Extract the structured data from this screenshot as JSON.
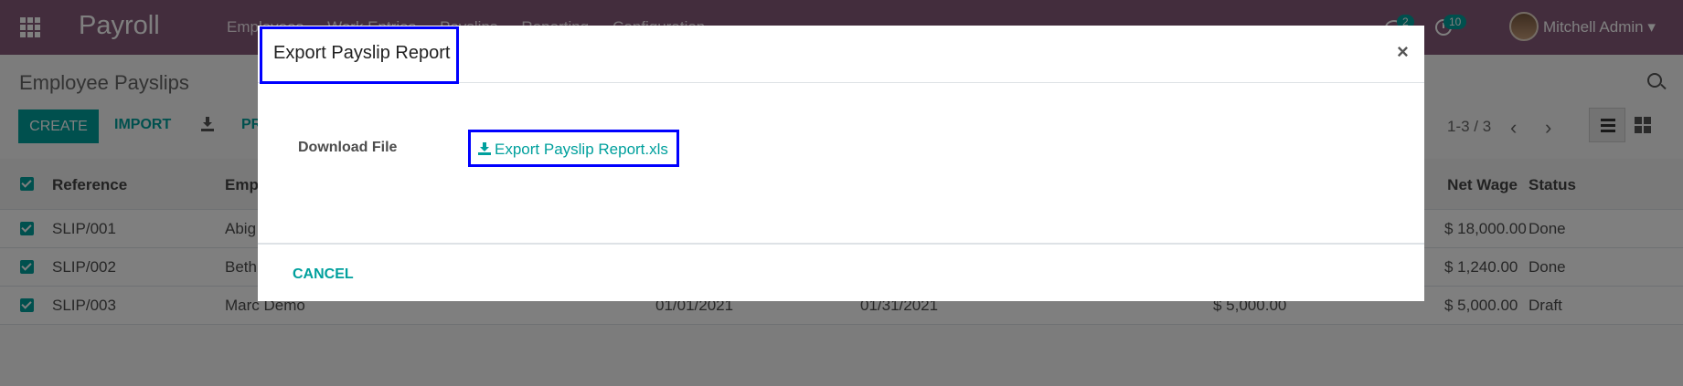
{
  "navbar": {
    "app_title": "Payroll",
    "menu": [
      "Employees",
      "Work Entries",
      "Payslips",
      "Reporting",
      "Configuration"
    ],
    "chat_count": "2",
    "activity_count": "10",
    "user_name": "Mitchell Admin"
  },
  "control_panel": {
    "page_title": "Employee Payslips",
    "create_label": "CREATE",
    "import_label": "IMPORT",
    "print_label": "PR",
    "pager": "1-3 / 3"
  },
  "table": {
    "headers": {
      "reference": "Reference",
      "employee": "Emp",
      "net_wage": "Net Wage",
      "status": "Status"
    },
    "rows": [
      {
        "reference": "SLIP/001",
        "employee": "Abig",
        "date_from": "",
        "date_to": "",
        "basic": "",
        "net_wage": "$ 18,000.00",
        "status": "Done"
      },
      {
        "reference": "SLIP/002",
        "employee": "Beth",
        "date_from": "",
        "date_to": "",
        "basic": "",
        "net_wage": "$ 1,240.00",
        "status": "Done"
      },
      {
        "reference": "SLIP/003",
        "employee": "Marc Demo",
        "date_from": "01/01/2021",
        "date_to": "01/31/2021",
        "basic": "$ 5,000.00",
        "net_wage": "$ 5,000.00",
        "status": "Draft"
      }
    ]
  },
  "modal": {
    "title": "Export Payslip Report",
    "close_symbol": "×",
    "download_label": "Download File",
    "file_name": "Export Payslip Report.xls",
    "cancel_label": "CANCEL"
  },
  "colors": {
    "navbar": "#875a7b",
    "accent": "#00a09d",
    "highlight_box": "#0000ff"
  }
}
